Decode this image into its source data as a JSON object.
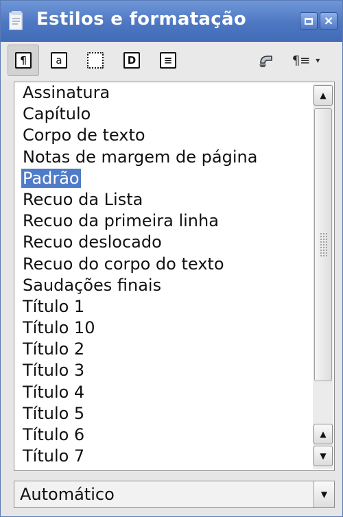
{
  "window": {
    "title": "Estilos e formatação"
  },
  "toolbar": {
    "tools": [
      {
        "icon": "paragraph-styles-icon",
        "glyph": "¶"
      },
      {
        "icon": "character-styles-icon",
        "glyph": "a"
      },
      {
        "icon": "frame-styles-icon",
        "glyph": ""
      },
      {
        "icon": "page-styles-icon",
        "glyph": "D"
      },
      {
        "icon": "list-styles-icon",
        "glyph": "≡"
      }
    ],
    "new_style_glyph": "¶≡",
    "dropdown_arrow": "▾"
  },
  "styles_list": {
    "items": [
      "Assinatura",
      "Capítulo",
      "Corpo de texto",
      "Notas de margem de página",
      "Padrão",
      "Recuo da Lista",
      "Recuo da primeira linha",
      "Recuo deslocado",
      "Recuo do corpo do texto",
      "Saudações finais",
      "Título 1",
      "Título 10",
      "Título 2",
      "Título 3",
      "Título 4",
      "Título 5",
      "Título 6",
      "Título 7"
    ],
    "selected": "Padrão"
  },
  "filter": {
    "value": "Automático"
  },
  "colors": {
    "titlebar": "#4d77c2",
    "selection": "#4f7bc9"
  }
}
